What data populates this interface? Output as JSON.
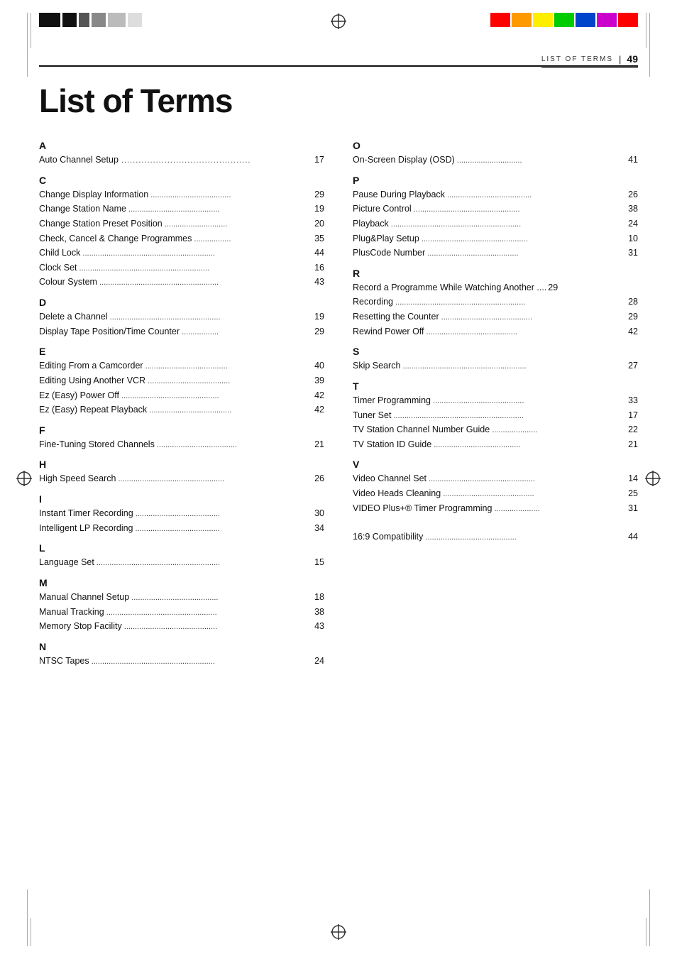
{
  "header": {
    "title": "LIST OF TERMS",
    "page": "49"
  },
  "big_title": "List of Terms",
  "left_column": [
    {
      "letter": "A",
      "entries": [
        {
          "name": "Auto Channel Setup",
          "dots": true,
          "page": "17"
        }
      ]
    },
    {
      "letter": "C",
      "entries": [
        {
          "name": "Change Display Information",
          "dots": true,
          "page": "29"
        },
        {
          "name": "Change Station Name",
          "dots": true,
          "page": "19"
        },
        {
          "name": "Change Station Preset Position",
          "dots": true,
          "page": "20"
        },
        {
          "name": "Check, Cancel & Change Programmes",
          "dots": true,
          "page": "35"
        },
        {
          "name": "Child Lock",
          "dots": true,
          "page": "44"
        },
        {
          "name": "Clock Set",
          "dots": true,
          "page": "16"
        },
        {
          "name": "Colour System",
          "dots": true,
          "page": "43"
        }
      ]
    },
    {
      "letter": "D",
      "entries": [
        {
          "name": "Delete a Channel",
          "dots": true,
          "page": "19"
        },
        {
          "name": "Display Tape Position/Time Counter",
          "dots": true,
          "page": "29"
        }
      ]
    },
    {
      "letter": "E",
      "entries": [
        {
          "name": "Editing From a Camcorder",
          "dots": true,
          "page": "40"
        },
        {
          "name": "Editing Using Another VCR",
          "dots": true,
          "page": "39"
        },
        {
          "name": "Ez (Easy) Power Off",
          "dots": true,
          "page": "42"
        },
        {
          "name": "Ez (Easy) Repeat Playback",
          "dots": true,
          "page": "42"
        }
      ]
    },
    {
      "letter": "F",
      "entries": [
        {
          "name": "Fine-Tuning Stored Channels",
          "dots": true,
          "page": "21"
        }
      ]
    },
    {
      "letter": "H",
      "entries": [
        {
          "name": "High Speed Search",
          "dots": true,
          "page": "26"
        }
      ]
    },
    {
      "letter": "I",
      "entries": [
        {
          "name": "Instant Timer Recording",
          "dots": true,
          "page": "30"
        },
        {
          "name": "Intelligent LP Recording",
          "dots": true,
          "page": "34"
        }
      ]
    },
    {
      "letter": "L",
      "entries": [
        {
          "name": "Language Set",
          "dots": true,
          "page": "15"
        }
      ]
    },
    {
      "letter": "M",
      "entries": [
        {
          "name": "Manual Channel Setup",
          "dots": true,
          "page": "18"
        },
        {
          "name": "Manual Tracking",
          "dots": true,
          "page": "38"
        },
        {
          "name": "Memory Stop Facility",
          "dots": true,
          "page": "43"
        }
      ]
    },
    {
      "letter": "N",
      "entries": [
        {
          "name": "NTSC Tapes",
          "dots": true,
          "page": "24"
        }
      ]
    }
  ],
  "right_column": [
    {
      "letter": "O",
      "entries": [
        {
          "name": "On-Screen Display (OSD)",
          "dots": true,
          "page": "41"
        }
      ]
    },
    {
      "letter": "P",
      "entries": [
        {
          "name": "Pause During Playback",
          "dots": true,
          "page": "26"
        },
        {
          "name": "Picture Control",
          "dots": true,
          "page": "38"
        },
        {
          "name": "Playback",
          "dots": true,
          "page": "24"
        },
        {
          "name": "Plug&Play Setup",
          "dots": true,
          "page": "10"
        },
        {
          "name": "PlusCode Number",
          "dots": true,
          "page": "31"
        }
      ]
    },
    {
      "letter": "R",
      "entries": [
        {
          "name": "Record a Programme While Watching Another",
          "dots": false,
          "page": "29"
        },
        {
          "name": "Recording",
          "dots": true,
          "page": "28"
        },
        {
          "name": "Resetting the Counter",
          "dots": true,
          "page": "29"
        },
        {
          "name": "Rewind Power Off",
          "dots": true,
          "page": "42"
        }
      ]
    },
    {
      "letter": "S",
      "entries": [
        {
          "name": "Skip Search",
          "dots": true,
          "page": "27"
        }
      ]
    },
    {
      "letter": "T",
      "entries": [
        {
          "name": "Timer Programming",
          "dots": true,
          "page": "33"
        },
        {
          "name": "Tuner Set",
          "dots": true,
          "page": "17"
        },
        {
          "name": "TV Station Channel Number Guide",
          "dots": true,
          "page": "22"
        },
        {
          "name": "TV Station ID Guide",
          "dots": true,
          "page": "21"
        }
      ]
    },
    {
      "letter": "V",
      "entries": [
        {
          "name": "Video Channel Set",
          "dots": true,
          "page": "14"
        },
        {
          "name": "Video Heads Cleaning",
          "dots": true,
          "page": "25"
        },
        {
          "name": "VIDEO Plus+® Timer Programming",
          "dots": true,
          "page": "31"
        }
      ]
    },
    {
      "letter": "",
      "entries": [
        {
          "name": "16:9 Compatibility",
          "dots": true,
          "page": "44"
        }
      ]
    }
  ],
  "colors": {
    "bar_colors": [
      "#ff0000",
      "#00aa00",
      "#0000ff",
      "#ffcc00",
      "#ff6600",
      "#cc0066"
    ],
    "black_bars": [
      "#111",
      "#555",
      "#999",
      "#ccc"
    ]
  }
}
